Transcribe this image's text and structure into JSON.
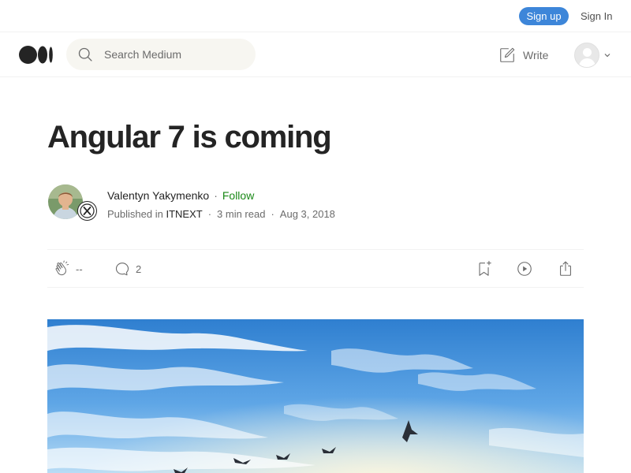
{
  "topbar": {
    "signup_label": "Sign up",
    "signin_label": "Sign In"
  },
  "header": {
    "logo_icon": "medium-logo-icon",
    "search": {
      "placeholder": "Search Medium",
      "icon": "search-icon"
    },
    "write_label": "Write",
    "write_icon": "pencil-square-icon",
    "avatar_icon": "user-avatar-icon"
  },
  "article": {
    "title": "Angular 7 is coming",
    "author": "Valentyn Yakymenko",
    "follow_label": "Follow",
    "published_in_prefix": "Published in",
    "publication": "ITNEXT",
    "read_time": "3 min read",
    "date": "Aug 3, 2018",
    "separator": "·"
  },
  "actions": {
    "clap_count": "--",
    "comment_count": "2",
    "icons": [
      "clap-icon",
      "comment-icon",
      "bookmark-add-icon",
      "play-listen-icon",
      "share-icon"
    ]
  },
  "colors": {
    "follow": "#1a8917",
    "signup": "#3d86d9",
    "text": "#242424",
    "muted": "#6b6b6b"
  }
}
